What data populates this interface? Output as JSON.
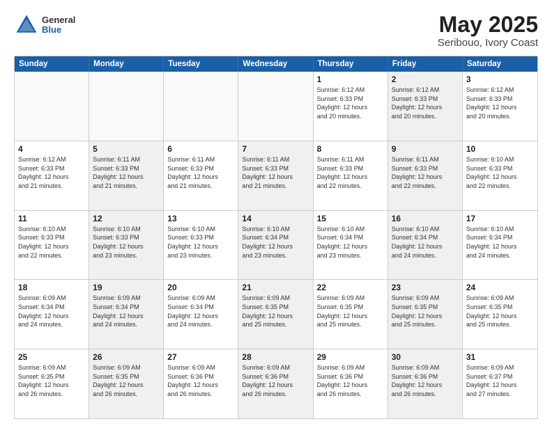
{
  "header": {
    "logo": {
      "general": "General",
      "blue": "Blue"
    },
    "title": "May 2025",
    "subtitle": "Seribouo, Ivory Coast"
  },
  "weekdays": [
    "Sunday",
    "Monday",
    "Tuesday",
    "Wednesday",
    "Thursday",
    "Friday",
    "Saturday"
  ],
  "rows": [
    [
      {
        "day": "",
        "info": "",
        "empty": true
      },
      {
        "day": "",
        "info": "",
        "empty": true
      },
      {
        "day": "",
        "info": "",
        "empty": true
      },
      {
        "day": "",
        "info": "",
        "empty": true
      },
      {
        "day": "1",
        "info": "Sunrise: 6:12 AM\nSunset: 6:33 PM\nDaylight: 12 hours\nand 20 minutes.",
        "empty": false
      },
      {
        "day": "2",
        "info": "Sunrise: 6:12 AM\nSunset: 6:33 PM\nDaylight: 12 hours\nand 20 minutes.",
        "empty": false,
        "shaded": true
      },
      {
        "day": "3",
        "info": "Sunrise: 6:12 AM\nSunset: 6:33 PM\nDaylight: 12 hours\nand 20 minutes.",
        "empty": false
      }
    ],
    [
      {
        "day": "4",
        "info": "Sunrise: 6:12 AM\nSunset: 6:33 PM\nDaylight: 12 hours\nand 21 minutes.",
        "empty": false
      },
      {
        "day": "5",
        "info": "Sunrise: 6:11 AM\nSunset: 6:33 PM\nDaylight: 12 hours\nand 21 minutes.",
        "empty": false,
        "shaded": true
      },
      {
        "day": "6",
        "info": "Sunrise: 6:11 AM\nSunset: 6:33 PM\nDaylight: 12 hours\nand 21 minutes.",
        "empty": false
      },
      {
        "day": "7",
        "info": "Sunrise: 6:11 AM\nSunset: 6:33 PM\nDaylight: 12 hours\nand 21 minutes.",
        "empty": false,
        "shaded": true
      },
      {
        "day": "8",
        "info": "Sunrise: 6:11 AM\nSunset: 6:33 PM\nDaylight: 12 hours\nand 22 minutes.",
        "empty": false
      },
      {
        "day": "9",
        "info": "Sunrise: 6:11 AM\nSunset: 6:33 PM\nDaylight: 12 hours\nand 22 minutes.",
        "empty": false,
        "shaded": true
      },
      {
        "day": "10",
        "info": "Sunrise: 6:10 AM\nSunset: 6:33 PM\nDaylight: 12 hours\nand 22 minutes.",
        "empty": false
      }
    ],
    [
      {
        "day": "11",
        "info": "Sunrise: 6:10 AM\nSunset: 6:33 PM\nDaylight: 12 hours\nand 22 minutes.",
        "empty": false
      },
      {
        "day": "12",
        "info": "Sunrise: 6:10 AM\nSunset: 6:33 PM\nDaylight: 12 hours\nand 23 minutes.",
        "empty": false,
        "shaded": true
      },
      {
        "day": "13",
        "info": "Sunrise: 6:10 AM\nSunset: 6:33 PM\nDaylight: 12 hours\nand 23 minutes.",
        "empty": false
      },
      {
        "day": "14",
        "info": "Sunrise: 6:10 AM\nSunset: 6:34 PM\nDaylight: 12 hours\nand 23 minutes.",
        "empty": false,
        "shaded": true
      },
      {
        "day": "15",
        "info": "Sunrise: 6:10 AM\nSunset: 6:34 PM\nDaylight: 12 hours\nand 23 minutes.",
        "empty": false
      },
      {
        "day": "16",
        "info": "Sunrise: 6:10 AM\nSunset: 6:34 PM\nDaylight: 12 hours\nand 24 minutes.",
        "empty": false,
        "shaded": true
      },
      {
        "day": "17",
        "info": "Sunrise: 6:10 AM\nSunset: 6:34 PM\nDaylight: 12 hours\nand 24 minutes.",
        "empty": false
      }
    ],
    [
      {
        "day": "18",
        "info": "Sunrise: 6:09 AM\nSunset: 6:34 PM\nDaylight: 12 hours\nand 24 minutes.",
        "empty": false
      },
      {
        "day": "19",
        "info": "Sunrise: 6:09 AM\nSunset: 6:34 PM\nDaylight: 12 hours\nand 24 minutes.",
        "empty": false,
        "shaded": true
      },
      {
        "day": "20",
        "info": "Sunrise: 6:09 AM\nSunset: 6:34 PM\nDaylight: 12 hours\nand 24 minutes.",
        "empty": false
      },
      {
        "day": "21",
        "info": "Sunrise: 6:09 AM\nSunset: 6:35 PM\nDaylight: 12 hours\nand 25 minutes.",
        "empty": false,
        "shaded": true
      },
      {
        "day": "22",
        "info": "Sunrise: 6:09 AM\nSunset: 6:35 PM\nDaylight: 12 hours\nand 25 minutes.",
        "empty": false
      },
      {
        "day": "23",
        "info": "Sunrise: 6:09 AM\nSunset: 6:35 PM\nDaylight: 12 hours\nand 25 minutes.",
        "empty": false,
        "shaded": true
      },
      {
        "day": "24",
        "info": "Sunrise: 6:09 AM\nSunset: 6:35 PM\nDaylight: 12 hours\nand 25 minutes.",
        "empty": false
      }
    ],
    [
      {
        "day": "25",
        "info": "Sunrise: 6:09 AM\nSunset: 6:35 PM\nDaylight: 12 hours\nand 26 minutes.",
        "empty": false
      },
      {
        "day": "26",
        "info": "Sunrise: 6:09 AM\nSunset: 6:35 PM\nDaylight: 12 hours\nand 26 minutes.",
        "empty": false,
        "shaded": true
      },
      {
        "day": "27",
        "info": "Sunrise: 6:09 AM\nSunset: 6:36 PM\nDaylight: 12 hours\nand 26 minutes.",
        "empty": false
      },
      {
        "day": "28",
        "info": "Sunrise: 6:09 AM\nSunset: 6:36 PM\nDaylight: 12 hours\nand 26 minutes.",
        "empty": false,
        "shaded": true
      },
      {
        "day": "29",
        "info": "Sunrise: 6:09 AM\nSunset: 6:36 PM\nDaylight: 12 hours\nand 26 minutes.",
        "empty": false
      },
      {
        "day": "30",
        "info": "Sunrise: 6:09 AM\nSunset: 6:36 PM\nDaylight: 12 hours\nand 26 minutes.",
        "empty": false,
        "shaded": true
      },
      {
        "day": "31",
        "info": "Sunrise: 6:09 AM\nSunset: 6:37 PM\nDaylight: 12 hours\nand 27 minutes.",
        "empty": false
      }
    ]
  ]
}
